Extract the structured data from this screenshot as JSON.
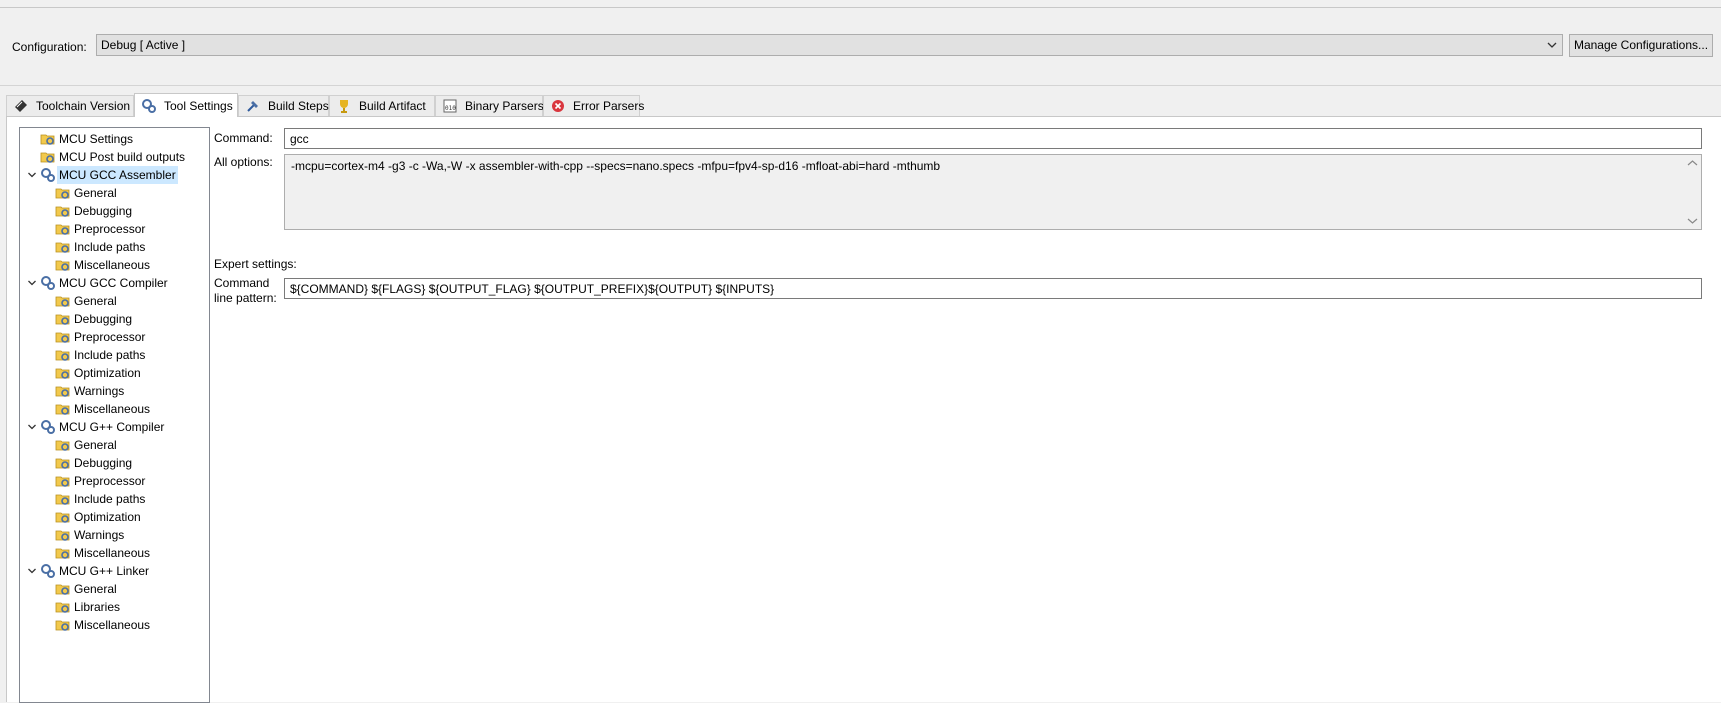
{
  "configuration": {
    "label": "Configuration:",
    "value": "Debug  [ Active ]",
    "manage_button": "Manage Configurations..."
  },
  "tabs": [
    {
      "label": "Toolchain  Version",
      "icon": "chip-icon"
    },
    {
      "label": "Tool Settings",
      "icon": "gears-icon",
      "active": true
    },
    {
      "label": "Build Steps",
      "icon": "hammer-icon"
    },
    {
      "label": "Build Artifact",
      "icon": "trophy-icon"
    },
    {
      "label": "Binary Parsers",
      "icon": "binary-icon"
    },
    {
      "label": "Error Parsers",
      "icon": "error-icon"
    }
  ],
  "tree": {
    "items": [
      {
        "label": "MCU Settings",
        "level": 1
      },
      {
        "label": "MCU Post build outputs",
        "level": 1
      },
      {
        "label": "MCU GCC Assembler",
        "level": 0,
        "expanded": true,
        "selected": true
      },
      {
        "label": "General",
        "level": 2
      },
      {
        "label": "Debugging",
        "level": 2
      },
      {
        "label": "Preprocessor",
        "level": 2
      },
      {
        "label": "Include paths",
        "level": 2
      },
      {
        "label": "Miscellaneous",
        "level": 2
      },
      {
        "label": "MCU GCC Compiler",
        "level": 0,
        "expanded": true
      },
      {
        "label": "General",
        "level": 2
      },
      {
        "label": "Debugging",
        "level": 2
      },
      {
        "label": "Preprocessor",
        "level": 2
      },
      {
        "label": "Include paths",
        "level": 2
      },
      {
        "label": "Optimization",
        "level": 2
      },
      {
        "label": "Warnings",
        "level": 2
      },
      {
        "label": "Miscellaneous",
        "level": 2
      },
      {
        "label": "MCU G++ Compiler",
        "level": 0,
        "expanded": true
      },
      {
        "label": "General",
        "level": 2
      },
      {
        "label": "Debugging",
        "level": 2
      },
      {
        "label": "Preprocessor",
        "level": 2
      },
      {
        "label": "Include paths",
        "level": 2
      },
      {
        "label": "Optimization",
        "level": 2
      },
      {
        "label": "Warnings",
        "level": 2
      },
      {
        "label": "Miscellaneous",
        "level": 2
      },
      {
        "label": "MCU G++ Linker",
        "level": 0,
        "expanded": true
      },
      {
        "label": "General",
        "level": 2
      },
      {
        "label": "Libraries",
        "level": 2
      },
      {
        "label": "Miscellaneous",
        "level": 2
      }
    ]
  },
  "settings": {
    "command_label": "Command:",
    "command_value": "gcc",
    "all_options_label": "All options:",
    "all_options_value": "-mcpu=cortex-m4 -g3 -c -Wa,-W -x assembler-with-cpp --specs=nano.specs -mfpu=fpv4-sp-d16 -mfloat-abi=hard -mthumb",
    "expert_label": "Expert settings:",
    "pattern_label_line1": "Command",
    "pattern_label_line2": "line pattern:",
    "pattern_value": "${COMMAND} ${FLAGS} ${OUTPUT_FLAG} ${OUTPUT_PREFIX}${OUTPUT} ${INPUTS}"
  }
}
